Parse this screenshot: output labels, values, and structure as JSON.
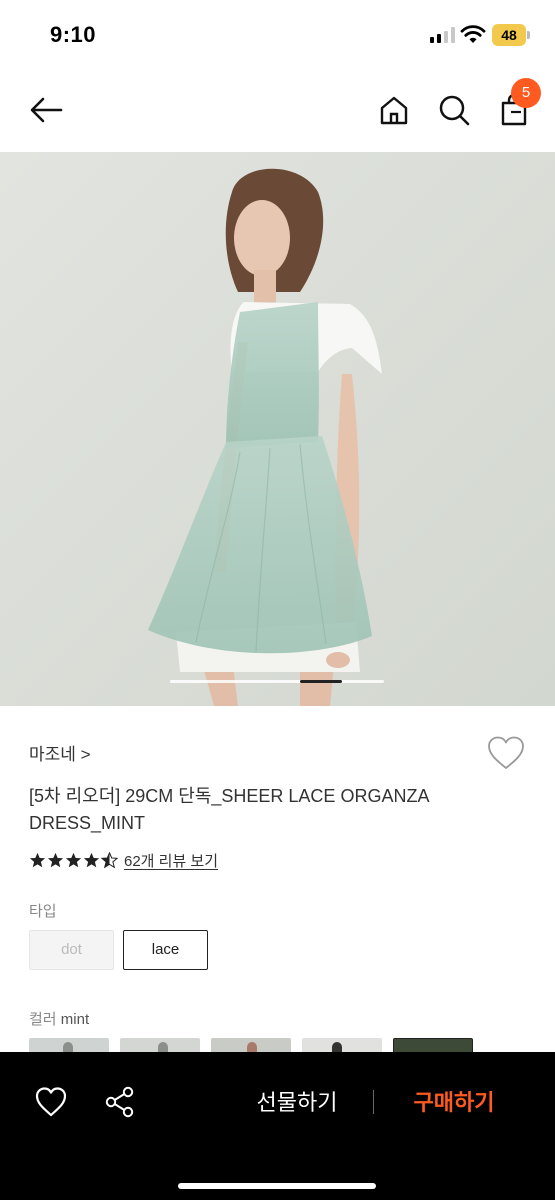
{
  "status_bar": {
    "time": "9:10",
    "battery": "48",
    "battery_color": "#f2c94c"
  },
  "nav": {
    "back_icon": "arrow-left-icon",
    "home_icon": "home-icon",
    "search_icon": "search-icon",
    "bag_icon": "shopping-bag-icon",
    "cart_count": "5",
    "badge_color": "#ff5a1f"
  },
  "product": {
    "image_pages": {
      "current": 3,
      "total": 5
    },
    "brand": "마조네 >",
    "title": "[5차 리오더] 29CM 단독_SHEER LACE ORGANZA DRESS_MINT",
    "rating": 4.5,
    "review_link": "62개 리뷰 보기"
  },
  "options": {
    "type_label": "타입",
    "types": [
      {
        "label": "dot",
        "state": "disabled"
      },
      {
        "label": "lace",
        "state": "selected"
      }
    ],
    "color_label": "컬러",
    "color_value": "mint",
    "swatch_count": 5,
    "selected_swatch": 5
  },
  "bottom_bar": {
    "heart_icon": "heart-outline-icon",
    "share_icon": "share-icon",
    "gift_label": "선물하기",
    "buy_label": "구매하기",
    "buy_color": "#ff5a1f"
  }
}
